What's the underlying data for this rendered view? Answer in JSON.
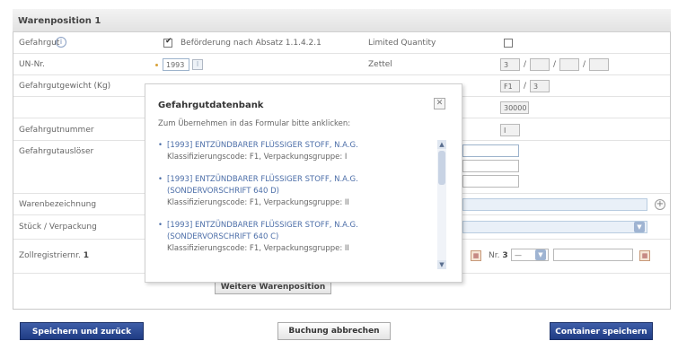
{
  "section": {
    "title": "Warenposition 1"
  },
  "labels": {
    "gefahrgut": "Gefahrgut",
    "un_nr": "UN-Nr.",
    "gewicht": "Gefahrgutgewicht (Kg)",
    "nummer": "Gefahrgutnummer",
    "ausloeser": "Gefahrgutauslöser",
    "warenbezeichnung": "Warenbezeichnung",
    "stueck": "Stück / Verpackung",
    "zollregister": "Zollregistriernr.",
    "zollregister_no": "1",
    "nr3": "Nr.",
    "nr3_no": "3"
  },
  "fields": {
    "befoerderung": "Beförderung nach Absatz 1.1.4.2.1",
    "befoerderung_checked": true,
    "limited_quantity": "Limited Quantity",
    "zettel": "Zettel",
    "un_value": "1993",
    "zettel_values": [
      "3",
      "",
      "",
      ""
    ],
    "klasse_values": [
      "F1",
      "3"
    ],
    "gewicht_value": "30000",
    "nummer_value": "I",
    "nr3_value": "—"
  },
  "popup": {
    "title": "Gefahrgutdatenbank",
    "hint": "Zum Übernehmen in das Formular bitte anklicken:",
    "items": [
      {
        "link": "[1993] ENTZÜNDBARER FLÜSSIGER STOFF, N.A.G.",
        "sub": "Klassifizierungscode: F1, Verpackungsgruppe: I"
      },
      {
        "link": "[1993] ENTZÜNDBARER FLÜSSIGER STOFF, N.A.G. (SONDERVORSCHRIFT 640 D)",
        "sub": "Klassifizierungscode: F1, Verpackungsgruppe: II"
      },
      {
        "link": "[1993] ENTZÜNDBARER FLÜSSIGER STOFF, N.A.G. (SONDERVORSCHRIFT 640 C)",
        "sub": "Klassifizierungscode: F1, Verpackungsgruppe: II"
      }
    ]
  },
  "buttons": {
    "weitere": "Weitere Warenposition",
    "speichern_zurueck": "Speichern und zurück",
    "abbrechen": "Buchung abbrechen",
    "container": "Container speichern"
  },
  "icons": {
    "info": "info-icon",
    "close": "close-icon",
    "add": "plus-icon",
    "calendar": "calendar-icon",
    "dropdown": "chevron-down-icon"
  },
  "colors": {
    "primary_button": "#1f3c84",
    "link": "#4c6ea8",
    "header_bar": "#e2e2e2",
    "required_dot": "#d8a23a"
  }
}
